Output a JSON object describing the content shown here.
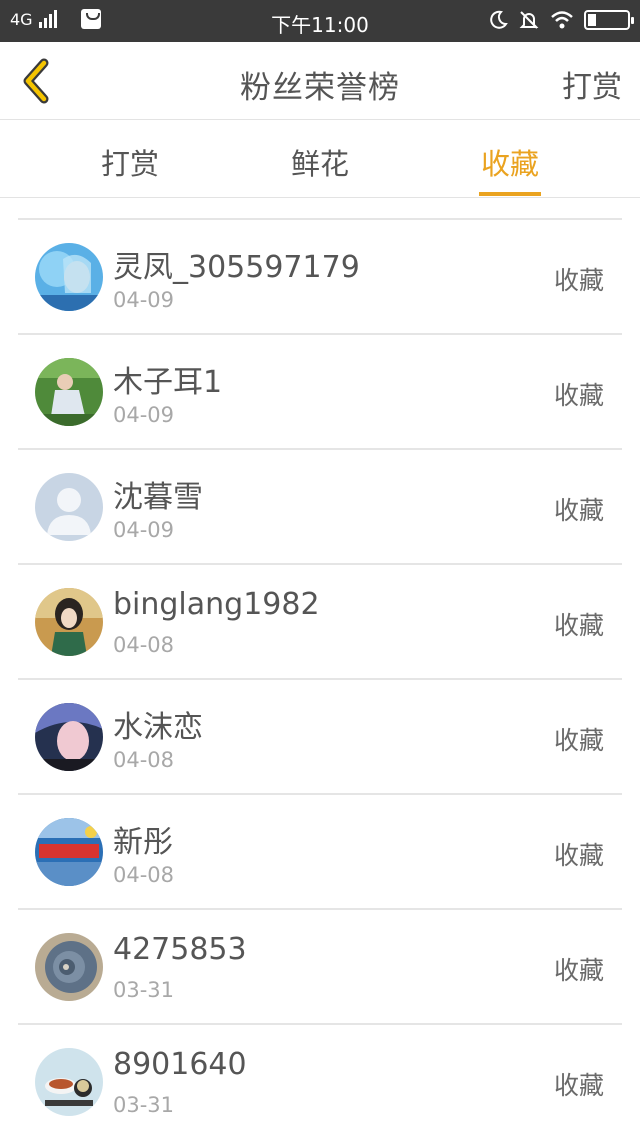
{
  "status_bar": {
    "network": "4G",
    "time": "下午11:00"
  },
  "header": {
    "title": "粉丝荣誉榜",
    "action": "打赏"
  },
  "tabs": [
    {
      "label": "打赏",
      "active": false
    },
    {
      "label": "鲜花",
      "active": false
    },
    {
      "label": "收藏",
      "active": true
    }
  ],
  "colors": {
    "accent": "#eaa320",
    "status_bar_bg": "#3a3a3a",
    "divider": "#e5e5e5"
  },
  "fans": [
    {
      "name": "灵凤_305597179",
      "date": "04-09",
      "tag": "收藏"
    },
    {
      "name": "木子耳1",
      "date": "04-09",
      "tag": "收藏"
    },
    {
      "name": "沈暮雪",
      "date": "04-09",
      "tag": "收藏"
    },
    {
      "name": "binglang1982",
      "date": "04-08",
      "tag": "收藏"
    },
    {
      "name": "水沫恋",
      "date": "04-08",
      "tag": "收藏"
    },
    {
      "name": "新彤",
      "date": "04-08",
      "tag": "收藏"
    },
    {
      "name": "4275853",
      "date": "03-31",
      "tag": "收藏"
    },
    {
      "name": "8901640",
      "date": "03-31",
      "tag": "收藏"
    }
  ]
}
